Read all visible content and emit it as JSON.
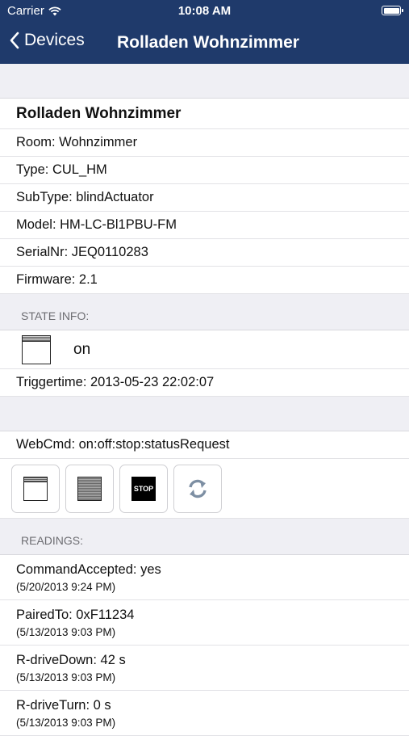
{
  "status_bar": {
    "carrier": "Carrier",
    "time": "10:08 AM"
  },
  "nav": {
    "back_label": "Devices",
    "title": "Rolladen Wohnzimmer"
  },
  "device": {
    "name": "Rolladen Wohnzimmer",
    "room": "Room: Wohnzimmer",
    "type": "Type: CUL_HM",
    "subtype": "SubType: blindActuator",
    "model": "Model: HM-LC-Bl1PBU-FM",
    "serial": "SerialNr: JEQ0110283",
    "firmware": "Firmware: 2.1"
  },
  "state_info": {
    "header": "STATE INFO:",
    "state": "on",
    "triggertime": "Triggertime: 2013-05-23 22:02:07"
  },
  "webcmd": {
    "label": "WebCmd: on:off:stop:statusRequest",
    "buttons": [
      {
        "icon": "blind-open-icon"
      },
      {
        "icon": "blind-closed-icon"
      },
      {
        "icon": "stop-icon",
        "text": "STOP"
      },
      {
        "icon": "refresh-icon"
      }
    ]
  },
  "readings": {
    "header": "READINGS:",
    "items": [
      {
        "label": "CommandAccepted: yes",
        "time": "(5/20/2013 9:24 PM)"
      },
      {
        "label": "PairedTo: 0xF11234",
        "time": "(5/13/2013 9:03 PM)"
      },
      {
        "label": "R-driveDown: 42 s",
        "time": "(5/13/2013 9:03 PM)"
      },
      {
        "label": "R-driveTurn: 0 s",
        "time": "(5/13/2013 9:03 PM)"
      }
    ]
  },
  "colors": {
    "nav_bg": "#1f3a6b",
    "page_bg": "#efeff4"
  }
}
